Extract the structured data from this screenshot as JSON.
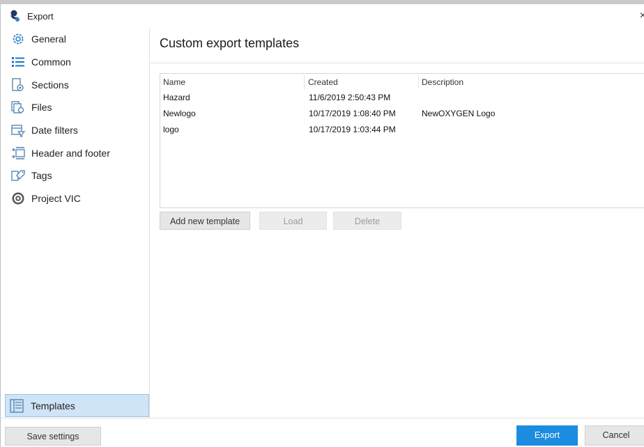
{
  "window": {
    "title": "Export",
    "icon": "app-logo-icon",
    "close_glyph": "×"
  },
  "sidebar": {
    "items": [
      {
        "label": "General",
        "icon": "gear-icon"
      },
      {
        "label": "Common",
        "icon": "list-icon"
      },
      {
        "label": "Sections",
        "icon": "sections-icon"
      },
      {
        "label": "Files",
        "icon": "files-icon"
      },
      {
        "label": "Date filters",
        "icon": "calendar-filter-icon"
      },
      {
        "label": "Header and footer",
        "icon": "header-footer-icon"
      },
      {
        "label": "Tags",
        "icon": "tags-icon"
      },
      {
        "label": "Project VIC",
        "icon": "project-vic-icon"
      }
    ],
    "selected": {
      "label": "Templates",
      "icon": "templates-icon"
    }
  },
  "main": {
    "title": "Custom export templates",
    "columns": [
      "Name",
      "Created",
      "Description"
    ],
    "rows": [
      {
        "name": "Hazard",
        "created": "11/6/2019 2:50:43 PM",
        "description": ""
      },
      {
        "name": "Newlogo",
        "created": "10/17/2019 1:08:40 PM",
        "description": "NewOXYGEN Logo"
      },
      {
        "name": "logo",
        "created": "10/17/2019 1:03:44 PM",
        "description": ""
      }
    ],
    "buttons": {
      "add": "Add new template",
      "load": "Load",
      "delete": "Delete"
    }
  },
  "footer": {
    "save": "Save settings",
    "export": "Export",
    "cancel": "Cancel"
  },
  "colors": {
    "accent": "#1c8ce0",
    "selected_bg": "#cfe4f7",
    "icon_blue": "#1a75c9"
  }
}
